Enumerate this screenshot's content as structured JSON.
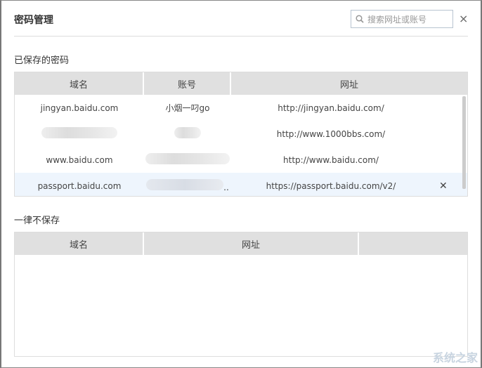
{
  "title": "密码管理",
  "search": {
    "placeholder": "搜索网址或账号"
  },
  "close_label": "×",
  "saved": {
    "label": "已保存的密码",
    "headers": [
      "域名",
      "账号",
      "网址"
    ],
    "rows": [
      {
        "domain": "jingyan.baidu.com",
        "account": "小烟一叼go",
        "url": "http://jingyan.baidu.com/"
      },
      {
        "domain": "",
        "account": "",
        "url": "http://www.1000bbs.com/"
      },
      {
        "domain": "www.baidu.com",
        "account": "",
        "url": "http://www.baidu.com/"
      },
      {
        "domain": "passport.baidu.com",
        "account": "..",
        "url": "https://passport.baidu.com/v2/",
        "delete": "✕"
      }
    ]
  },
  "never": {
    "label": "一律不保存",
    "headers": [
      "域名",
      "网址"
    ]
  },
  "watermark": "系统之家"
}
